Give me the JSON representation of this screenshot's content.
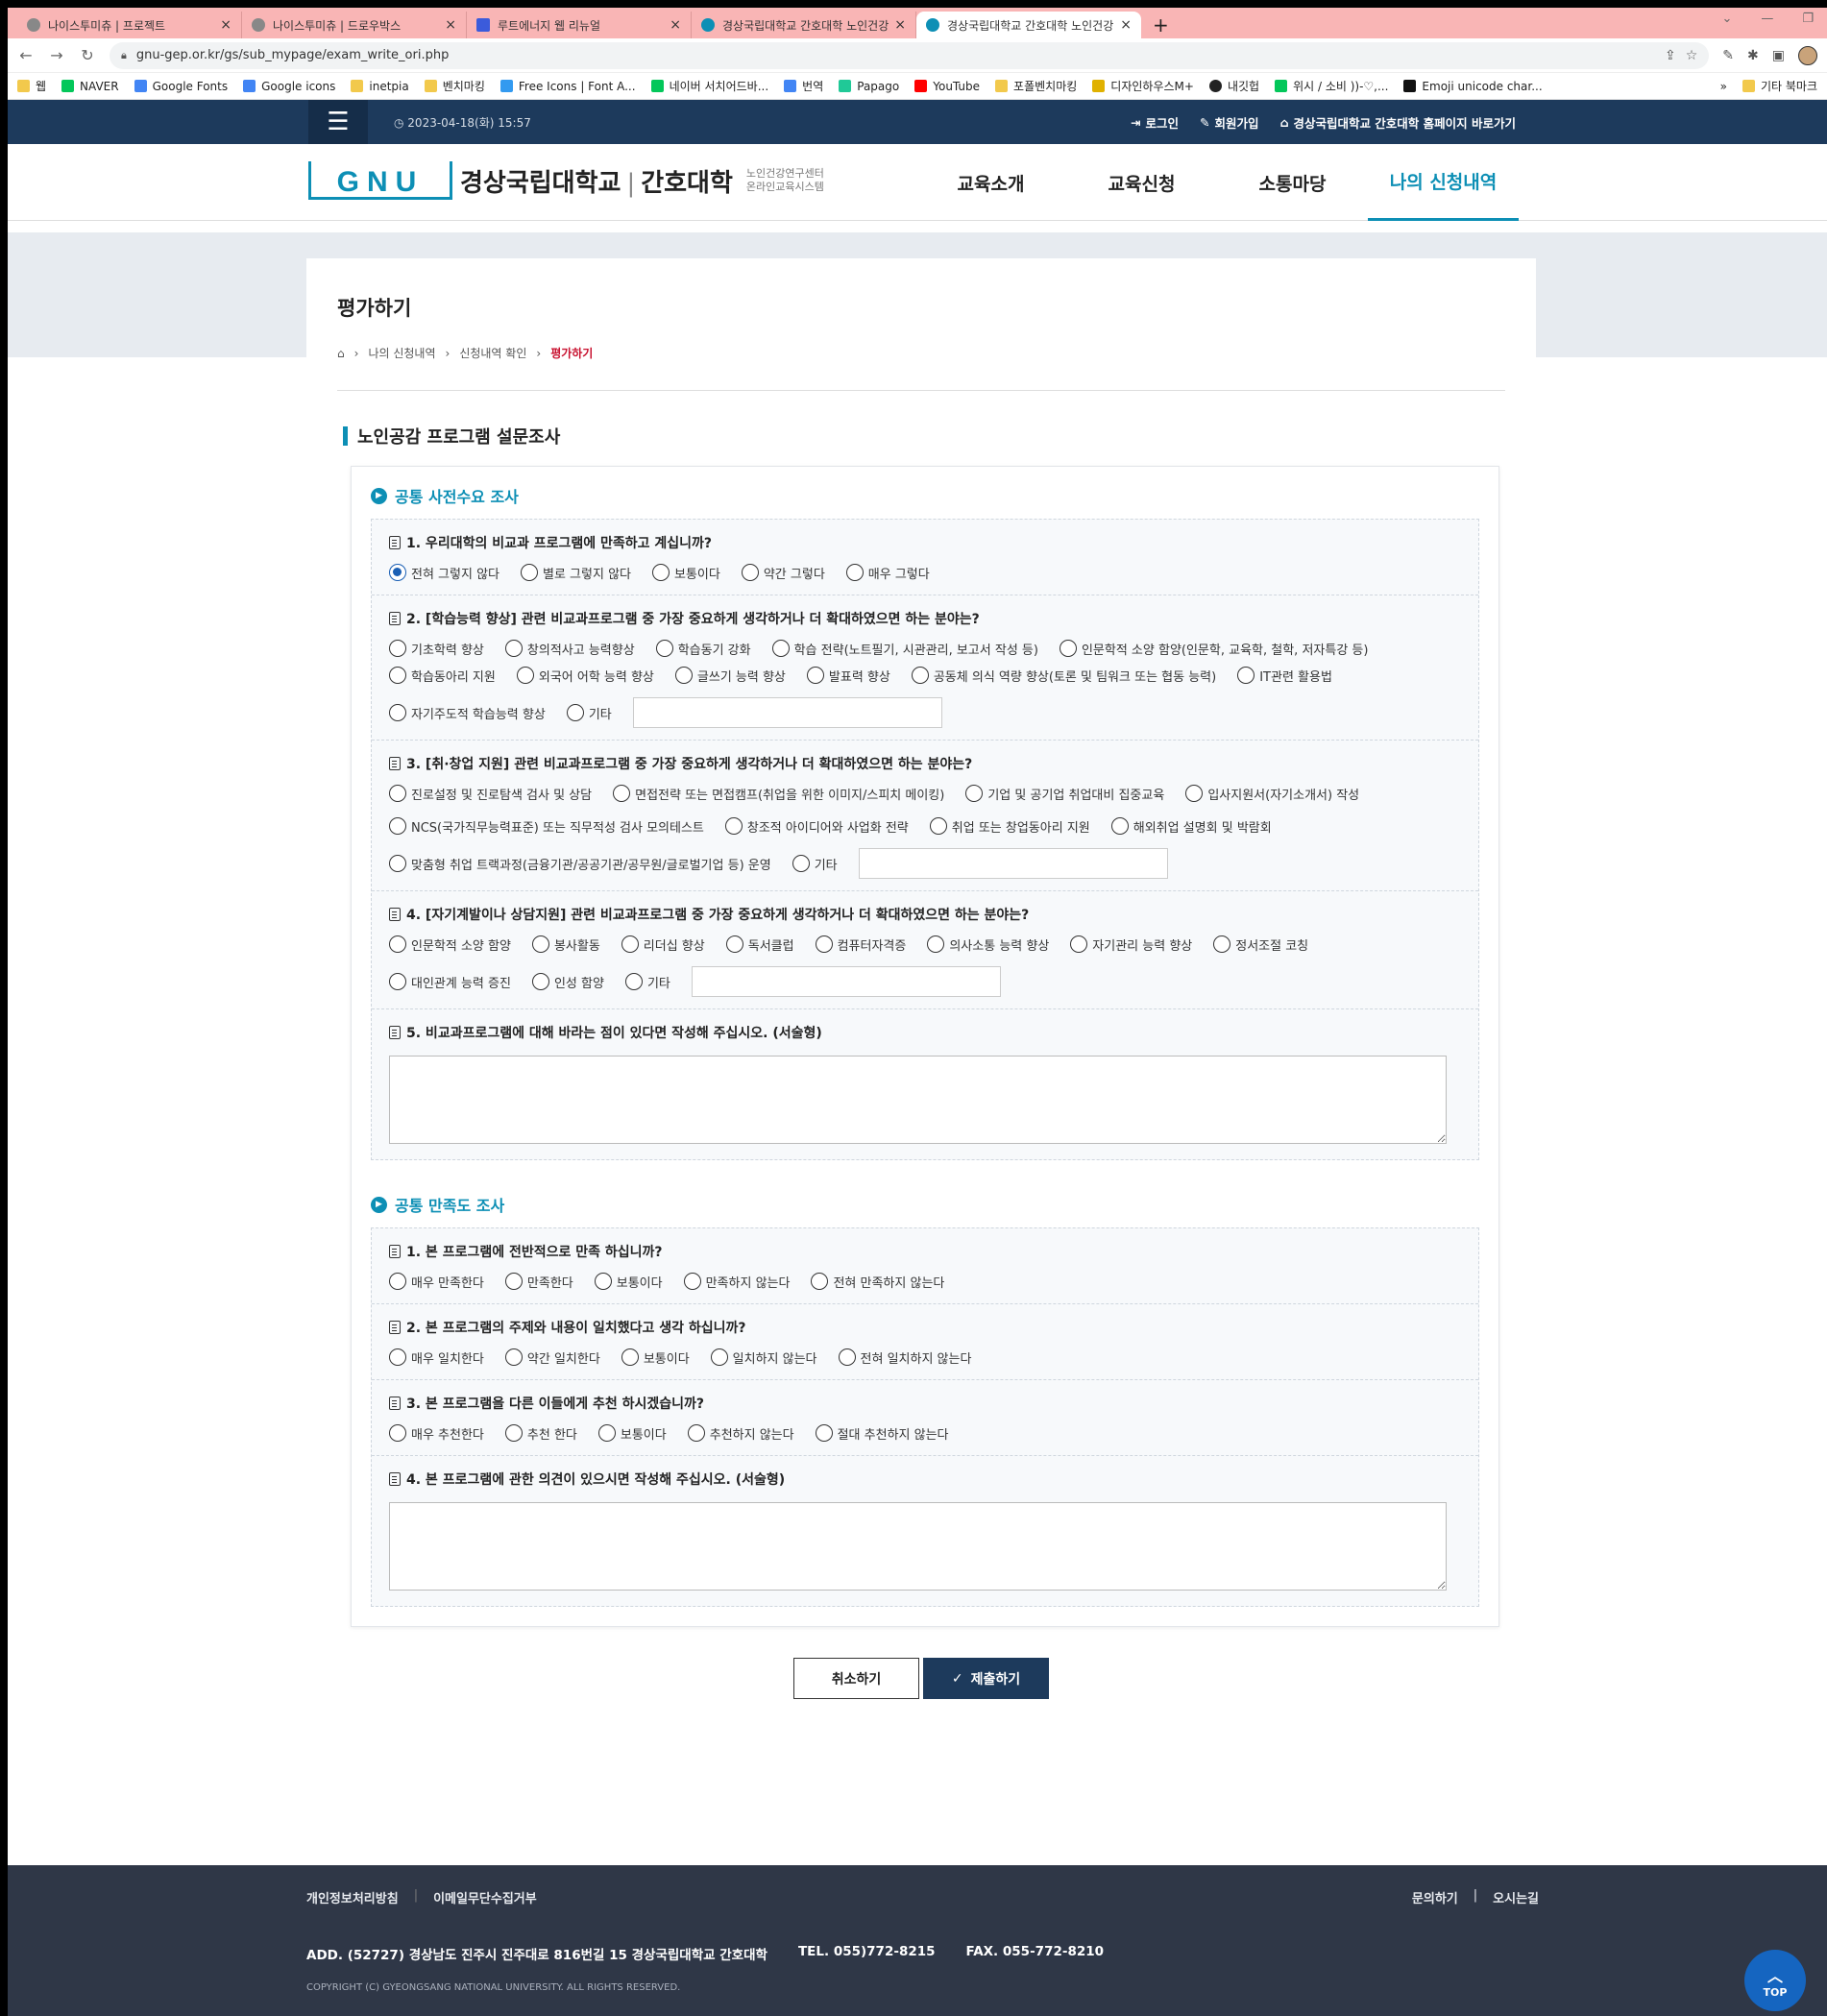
{
  "browser": {
    "tabs": [
      {
        "title": "나이스투미츄 | 프로젝트"
      },
      {
        "title": "나이스투미츄 | 드로우박스"
      },
      {
        "title": "루트에너지 웹 리뉴얼"
      },
      {
        "title": "경상국립대학교 간호대학 노인건강"
      },
      {
        "title": "경상국립대학교 간호대학 노인건강"
      }
    ],
    "url": "gnu-gep.or.kr/gs/sub_mypage/exam_write_ori.php",
    "bookmarks": [
      "웹",
      "NAVER",
      "Google Fonts",
      "Google icons",
      "inetpia",
      "벤치마킹",
      "Free Icons | Font A...",
      "네이버 서치어드바...",
      "번역",
      "Papago",
      "YouTube",
      "포폴벤치마킹",
      "디자인하우스M+",
      "내깃헙",
      "위시 / 소비 ))-♡,...",
      "Emoji unicode char...",
      "기타 북마크"
    ]
  },
  "site": {
    "date": "2023-04-18(화) 15:57",
    "login": "로그인",
    "signup": "회원가입",
    "homepage_link": "경상국립대학교 간호대학 홈페이지 바로가기",
    "logo_mark": "GNU",
    "logo_main": "경상국립대학교",
    "logo_sub_main": "간호대학",
    "logo_sub1": "노인건강연구센터",
    "logo_sub2": "온라인교육시스템",
    "nav": [
      "교육소개",
      "교육신청",
      "소통마당",
      "나의 신청내역"
    ]
  },
  "page": {
    "title": "평가하기",
    "breadcrumb": [
      "나의 신청내역",
      "신청내역 확인",
      "평가하기"
    ],
    "survey_title": "노인공감 프로그램 설문조사"
  },
  "survey": {
    "group1": {
      "title": "공통 사전수요 조사",
      "q1": {
        "text": "1. 우리대학의 비교과 프로그램에 만족하고 계십니까?",
        "options": [
          "전혀 그렇지 않다",
          "별로 그렇지 않다",
          "보통이다",
          "약간 그렇다",
          "매우 그렇다"
        ],
        "selected": 0
      },
      "q2": {
        "text": "2. [학습능력 향상] 관련 비교과프로그램 중 가장 중요하게 생각하거나 더 확대하였으면 하는 분야는?",
        "options": [
          "기초학력 향상",
          "창의적사고 능력향상",
          "학습동기 강화",
          "학습 전략(노트필기, 시관관리, 보고서 작성 등)",
          "인문학적 소양 함양(인문학, 교육학, 철학, 저자특강 등)",
          "학습동아리 지원",
          "외국어 어학 능력 향상",
          "글쓰기 능력 향상",
          "발표력 향상",
          "공동체 의식 역량 향상(토론 및 팀워크 또는 협동 능력)",
          "IT관련 활용법",
          "자기주도적 학습능력 향상",
          "기타"
        ]
      },
      "q3": {
        "text": "3. [취·창업 지원] 관련 비교과프로그램 중 가장 중요하게 생각하거나 더 확대하였으면 하는 분야는?",
        "options": [
          "진로설정 및 진로탐색 검사 및 상담",
          "면접전략 또는 면접캠프(취업을 위한 이미지/스피치 메이킹)",
          "기업 및 공기업 취업대비 집중교육",
          "입사지원서(자기소개서) 작성",
          "NCS(국가직무능력표준) 또는 직무적성 검사 모의테스트",
          "창조적 아이디어와 사업화 전략",
          "취업 또는 창업동아리 지원",
          "해외취업 설명회 및 박람회",
          "맞춤형 취업 트랙과정(금융기관/공공기관/공무원/글로벌기업 등) 운영",
          "기타"
        ]
      },
      "q4": {
        "text": "4. [자기계발이나 상담지원] 관련 비교과프로그램 중 가장 중요하게 생각하거나 더 확대하였으면 하는 분야는?",
        "options": [
          "인문학적 소양 함양",
          "봉사활동",
          "리더십 향상",
          "독서클럽",
          "컴퓨터자격증",
          "의사소통 능력 향상",
          "자기관리 능력 향상",
          "정서조절 코칭",
          "대인관계 능력 증진",
          "인성 함양",
          "기타"
        ]
      },
      "q5": {
        "text": "5. 비교과프로그램에 대해 바라는 점이 있다면 작성해 주십시오. (서술형)"
      }
    },
    "group2": {
      "title": "공통 만족도 조사",
      "q1": {
        "text": "1. 본 프로그램에 전반적으로 만족 하십니까?",
        "options": [
          "매우 만족한다",
          "만족한다",
          "보통이다",
          "만족하지 않는다",
          "전혀 만족하지 않는다"
        ]
      },
      "q2": {
        "text": "2. 본 프로그램의 주제와 내용이 일치했다고 생각 하십니까?",
        "options": [
          "매우 일치한다",
          "약간 일치한다",
          "보통이다",
          "일치하지 않는다",
          "전혀 일치하지 않는다"
        ]
      },
      "q3": {
        "text": "3. 본 프로그램을 다른 이들에게 추천 하시겠습니까?",
        "options": [
          "매우 추천한다",
          "추천 한다",
          "보통이다",
          "추천하지 않는다",
          "절대 추천하지 않는다"
        ]
      },
      "q4": {
        "text": "4. 본 프로그램에 관한 의견이 있으시면 작성해 주십시오. (서술형)"
      }
    }
  },
  "buttons": {
    "cancel": "취소하기",
    "submit": "제출하기"
  },
  "footer": {
    "privacy": "개인정보처리방침",
    "email_reject": "이메일무단수집거부",
    "inquiry": "문의하기",
    "directions": "오시는길",
    "address": "ADD. (52727) 경상남도 진주시 진주대로 816번길 15 경상국립대학교 간호대학",
    "tel": "TEL. 055)772-8215",
    "fax": "FAX. 055-772-8210",
    "copyright": "COPYRIGHT (C) GYEONGSANG NATIONAL UNIVERSITY. ALL RIGHTS RESERVED.",
    "top": "TOP"
  }
}
